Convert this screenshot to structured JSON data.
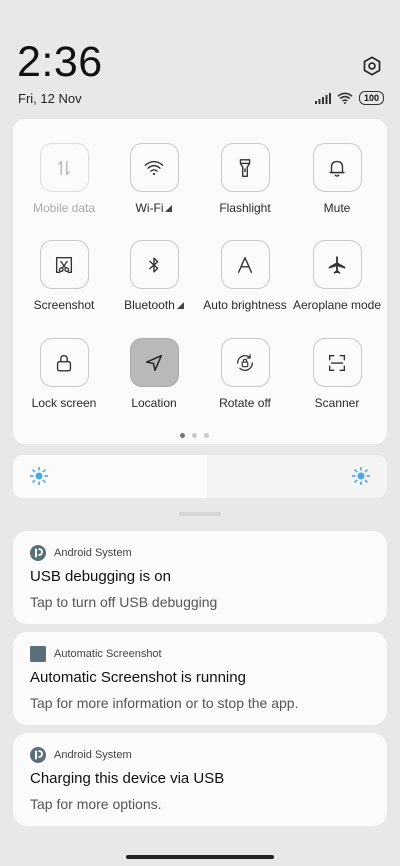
{
  "header": {
    "time": "2:36",
    "date": "Fri, 12 Nov",
    "battery": "100"
  },
  "tiles": [
    {
      "label": "Mobile data",
      "icon": "mobile-data-icon",
      "state": "disabled"
    },
    {
      "label": "Wi-Fi",
      "icon": "wifi-icon",
      "state": "normal",
      "expandable": true
    },
    {
      "label": "Flashlight",
      "icon": "flashlight-icon",
      "state": "normal"
    },
    {
      "label": "Mute",
      "icon": "bell-icon",
      "state": "normal"
    },
    {
      "label": "Screenshot",
      "icon": "screenshot-icon",
      "state": "normal"
    },
    {
      "label": "Bluetooth",
      "icon": "bluetooth-icon",
      "state": "normal",
      "expandable": true
    },
    {
      "label": "Auto brightness",
      "icon": "auto-brightness-icon",
      "state": "normal"
    },
    {
      "label": "Aeroplane mode",
      "icon": "airplane-icon",
      "state": "normal"
    },
    {
      "label": "Lock screen",
      "icon": "lock-icon",
      "state": "normal"
    },
    {
      "label": "Location",
      "icon": "location-icon",
      "state": "active"
    },
    {
      "label": "Rotate off",
      "icon": "rotate-lock-icon",
      "state": "normal"
    },
    {
      "label": "Scanner",
      "icon": "scanner-icon",
      "state": "normal"
    }
  ],
  "pager": {
    "pages": 3,
    "current": 0
  },
  "brightness": {
    "level": 0.52
  },
  "notifications": [
    {
      "app": "Android System",
      "icon": "android-system-icon",
      "title": "USB debugging is on",
      "text": "Tap to turn off USB debugging"
    },
    {
      "app": "Automatic Screenshot",
      "icon": "automatic-screenshot-icon",
      "title": "Automatic Screenshot is running",
      "text": "Tap for more information or to stop the app."
    },
    {
      "app": "Android System",
      "icon": "android-system-icon",
      "title": "Charging this device via USB",
      "text": "Tap for more options."
    }
  ],
  "colors": {
    "background": "#e8e8e8",
    "panel": "#fbfbfb",
    "active_tile": "#b9b9b9",
    "sun": "#4aa9e0",
    "app_icon": "#5b6f78"
  }
}
